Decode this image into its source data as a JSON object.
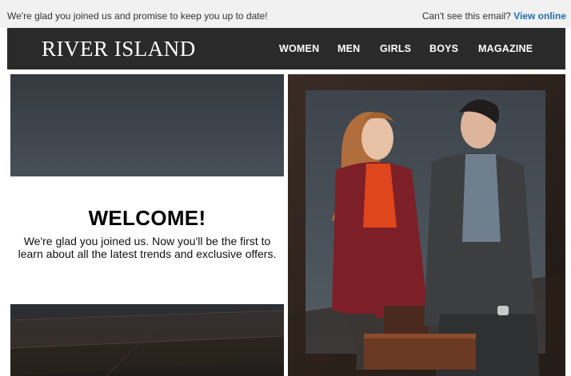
{
  "preheader": {
    "message": "We're glad you joined us and promise to keep you up to date!",
    "cant_see": "Can't see this email?",
    "view_online": "View online"
  },
  "header": {
    "logo": "RIVER ISLAND",
    "nav": [
      "WOMEN",
      "MEN",
      "GIRLS",
      "BOYS",
      "MAGAZINE"
    ]
  },
  "welcome": {
    "title": "WELCOME!",
    "body": "We're glad you joined us. Now you'll be the first to learn about all the latest trends and exclusive offers."
  },
  "hero_image": {
    "description_icon": "couple-fashion-photo",
    "colors": {
      "backdrop": "#4a525a",
      "coat": "#7d1f27",
      "top": "#e0461b",
      "suit": "#3c3e40"
    }
  },
  "colors": {
    "preheader_bg": "#f1f1f1",
    "nav_bg": "#2a2a2a",
    "link": "#1f6fb6"
  }
}
